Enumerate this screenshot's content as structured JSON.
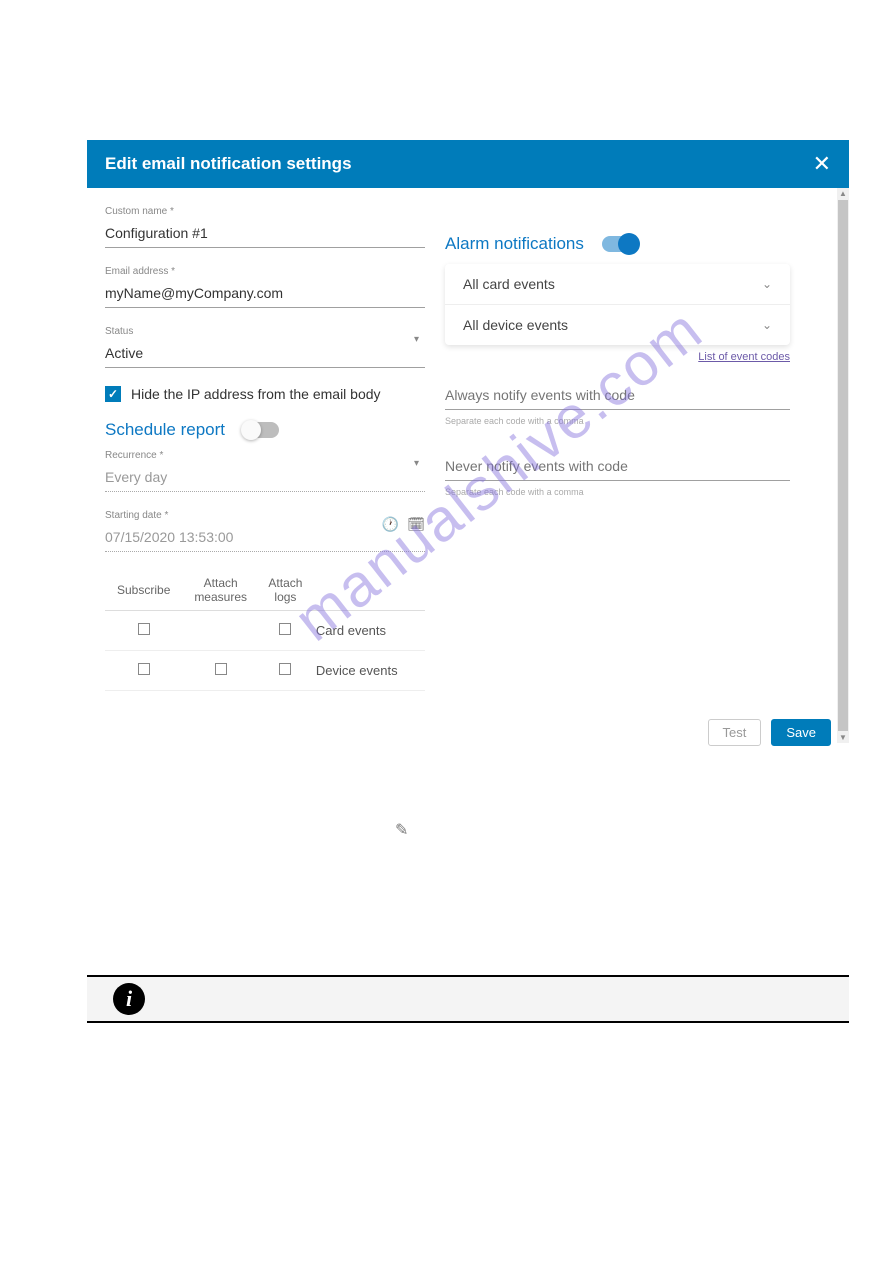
{
  "dialog": {
    "title": "Edit email notification settings"
  },
  "form": {
    "customName": {
      "label": "Custom name *",
      "value": "Configuration #1"
    },
    "email": {
      "label": "Email address *",
      "value": "myName@myCompany.com"
    },
    "status": {
      "label": "Status",
      "value": "Active"
    },
    "hideIp": {
      "label": "Hide the IP address from the email body"
    },
    "schedule": {
      "title": "Schedule report"
    },
    "recurrence": {
      "label": "Recurrence *",
      "value": "Every day"
    },
    "startDate": {
      "label": "Starting date *",
      "value": "07/15/2020 13:53:00"
    },
    "table": {
      "headers": {
        "subscribe": "Subscribe",
        "measures": "Attach\nmeasures",
        "logs": "Attach\nlogs"
      },
      "rows": [
        {
          "label": "Card events"
        },
        {
          "label": "Device events"
        }
      ]
    }
  },
  "alarm": {
    "title": "Alarm notifications",
    "items": [
      "All card events",
      "All device events"
    ],
    "link": "List of event codes",
    "always": "Always notify events with code",
    "never": "Never notify events with code",
    "hint": "Separate each code with a comma"
  },
  "footer": {
    "test": "Test",
    "save": "Save"
  },
  "watermark": "manualshive.com"
}
